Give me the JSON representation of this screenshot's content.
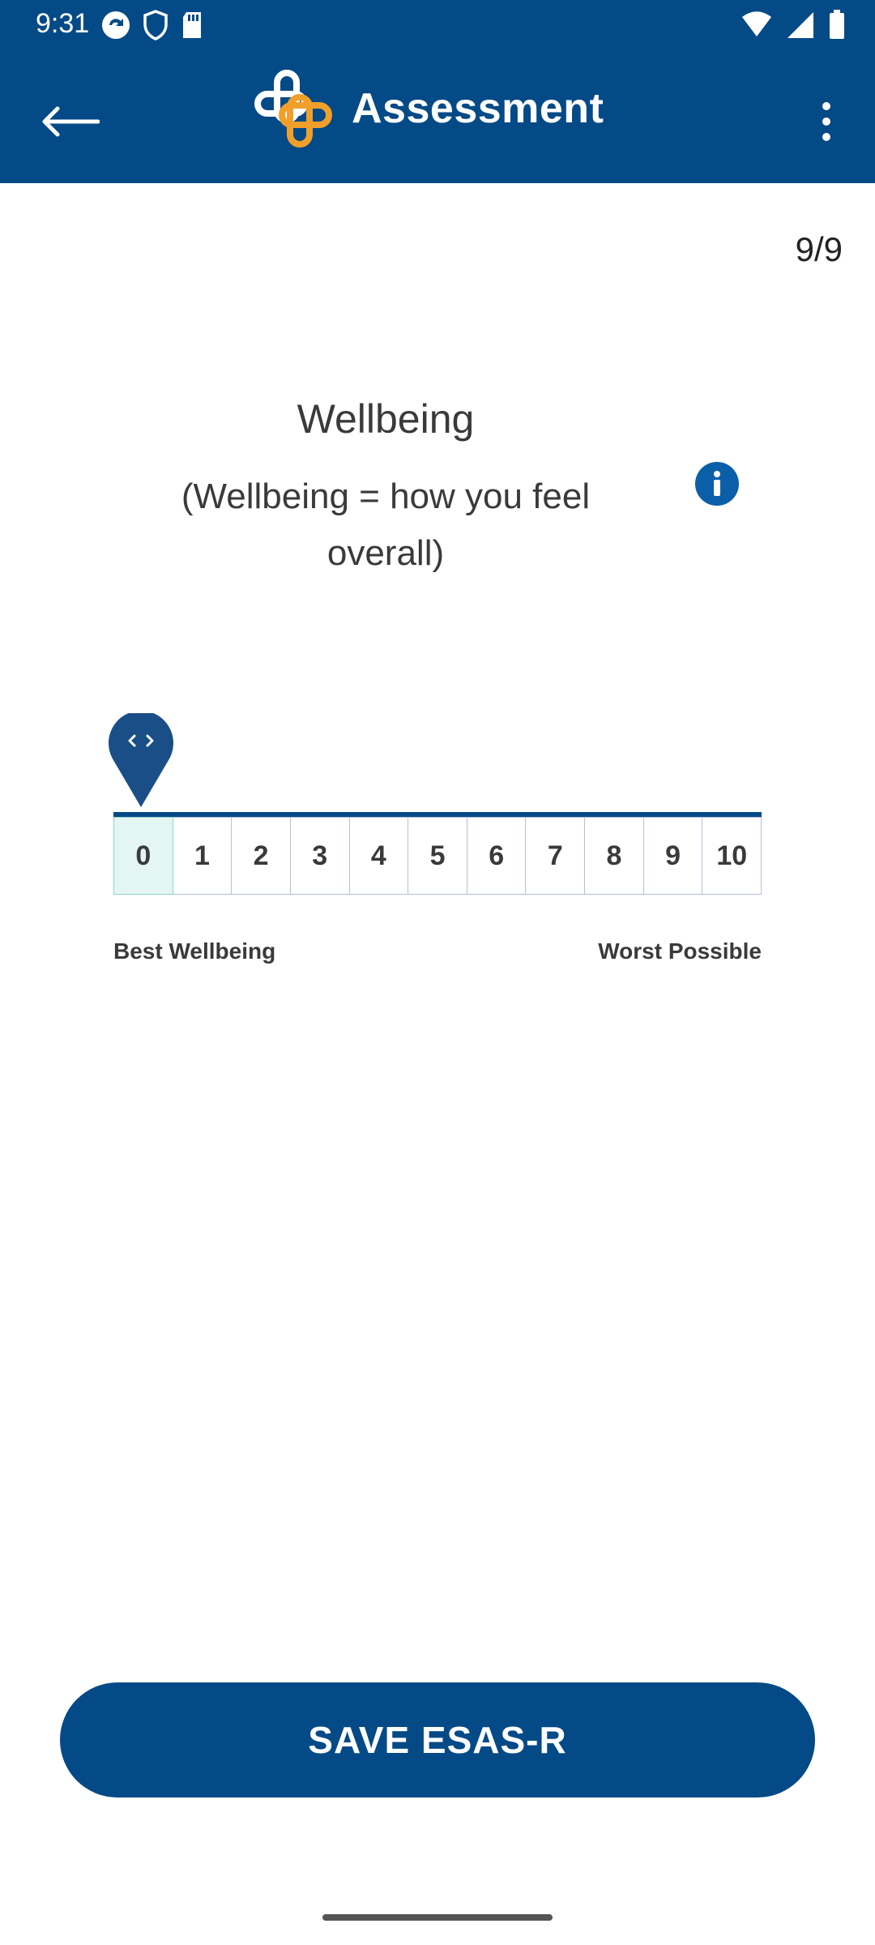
{
  "status_bar": {
    "time": "9:31"
  },
  "app_bar": {
    "title": "Assessment",
    "back_icon": "arrow-left-icon",
    "more_icon": "more-vertical-icon",
    "logo_colors": [
      "#ffffff",
      "#f0a02a"
    ]
  },
  "progress": "9/9",
  "question": {
    "title": "Wellbeing",
    "subtitle": "(Wellbeing = how you feel overall)"
  },
  "scale": {
    "options": [
      "0",
      "1",
      "2",
      "3",
      "4",
      "5",
      "6",
      "7",
      "8",
      "9",
      "10"
    ],
    "selected": "0",
    "min_label": "Best Wellbeing",
    "max_label": "Worst Possible"
  },
  "save_button": "SAVE ESAS-R",
  "colors": {
    "primary": "#044a87",
    "selected_bg": "#e3f6f3",
    "info": "#0a5fa8",
    "accent": "#f0a02a"
  }
}
